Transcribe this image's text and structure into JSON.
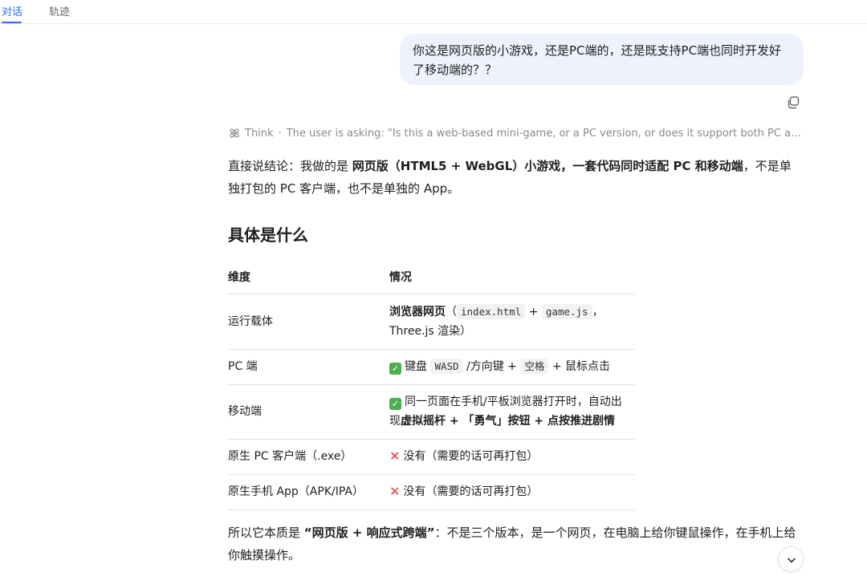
{
  "tabs": [
    {
      "label": "对话",
      "active": true
    },
    {
      "label": "轨迹",
      "active": false
    }
  ],
  "user_message": "你这是网页版的小游戏，还是PC端的，还是既支持PC端也同时开发好了移动端的？？",
  "think": {
    "label": "Think",
    "summary": "The user is asking: \"Is this a web-based mini-game, or a PC version, or does it support both PC and m..."
  },
  "answer": {
    "intro": {
      "p1": "直接说结论：我做的是 ",
      "b1": "网页版（HTML5 + WebGL）小游戏，一套代码同时适配 PC 和移动端",
      "p2": "，不是单独打包的 PC 客户端，也不是单独的 App。"
    },
    "section_title": "具体是什么",
    "table": {
      "headers": [
        "维度",
        "情况"
      ],
      "rows": [
        {
          "dim": "运行载体",
          "b": "浏览器网页",
          "t1": "（",
          "code1": "index.html",
          "t2": " + ",
          "code2": "game.js",
          "t3": "，",
          "t4": "Three.js 渲染）"
        },
        {
          "dim": "PC 端",
          "t1": "键盘 ",
          "code1": "WASD",
          "t2": " /方向键 + ",
          "code2": "空格",
          "t3": " + 鼠标点击"
        },
        {
          "dim": "移动端",
          "t1": "同一页面在手机/平板浏览器打开时，自动出",
          "t2": "现",
          "b": "虚拟摇杆 + 「勇气」按钮 + 点按推进剧情"
        },
        {
          "dim": "原生 PC 客户端（.exe）",
          "t1": "没有（需要的话可再打包）"
        },
        {
          "dim": "原生手机 App（APK/IPA）",
          "t1": "没有（需要的话可再打包）"
        }
      ]
    },
    "summary": {
      "p1": "所以它本质是 ",
      "b1": "“网页版 + 响应式跨端”",
      "p2": "：不是三个版本，是一个网页，在电脑上给你键鼠操作，在手机上给你触摸操作。"
    }
  },
  "icons": {
    "copy": "copy-icon",
    "think": "think-icon",
    "scroll_down": "chevron-down-icon",
    "check": "check-mark-emoji",
    "cross": "cross-mark-emoji"
  },
  "colors": {
    "accent": "#2b6cf0",
    "user_bubble": "#eef2fc",
    "check_green": "#4caf50",
    "cross_red": "#e53935"
  }
}
